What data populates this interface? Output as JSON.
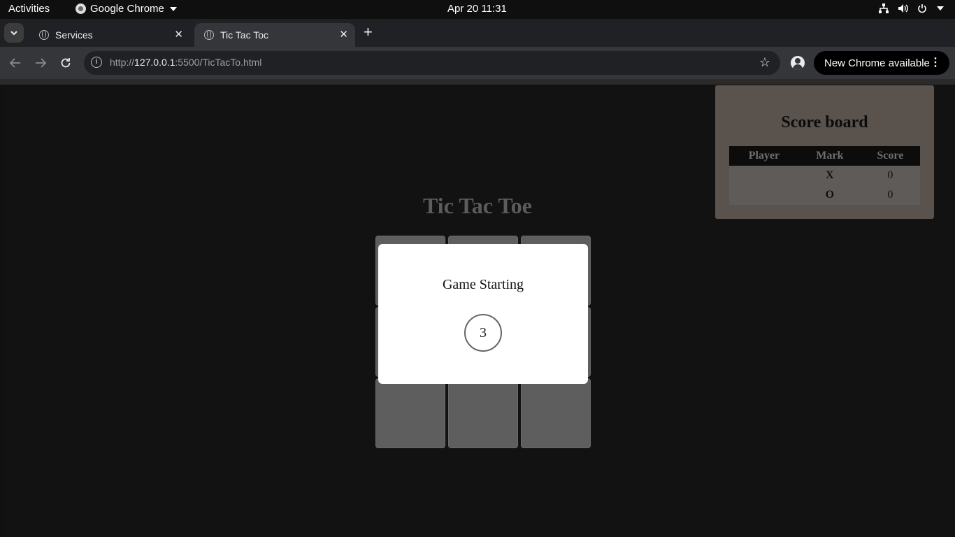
{
  "system": {
    "activities": "Activities",
    "app_name": "Google Chrome",
    "clock": "Apr 20  11:31"
  },
  "browser": {
    "tabs": [
      {
        "title": "Services",
        "active": false
      },
      {
        "title": "Tic Tac Toc",
        "active": true
      }
    ],
    "url_prefix": "http://",
    "url_host": "127.0.0.1",
    "url_rest": ":5500/TicTacTo.html",
    "update_label": "New Chrome available"
  },
  "game": {
    "title": "Tic Tac Toe",
    "board": [
      "",
      "",
      "",
      "",
      "",
      "",
      "",
      "",
      ""
    ]
  },
  "scoreboard": {
    "title": "Score board",
    "headers": [
      "Player",
      "Mark",
      "Score"
    ],
    "rows": [
      {
        "player": "",
        "mark": "X",
        "score": "0"
      },
      {
        "player": "",
        "mark": "O",
        "score": "0"
      }
    ]
  },
  "modal": {
    "message": "Game Starting",
    "countdown": "3"
  },
  "colors": {
    "mark_x": "#22227a",
    "mark_o": "#1b5a20",
    "modal_bg": "#ffffff"
  }
}
